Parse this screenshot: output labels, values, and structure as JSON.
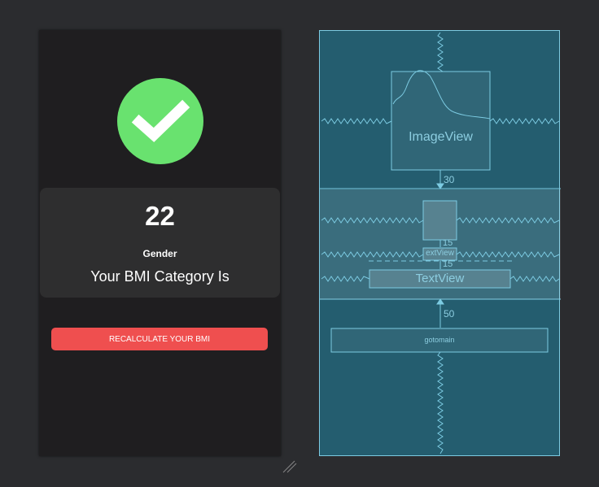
{
  "design": {
    "bmi_value": "22",
    "gender_label": "Gender",
    "category_text": "Your BMI Category Is",
    "recalculate_label": "RECALCULATE YOUR BMI",
    "check_icon": "checkmark-icon",
    "colors": {
      "check_bg": "#69e26f",
      "button_bg": "#ef4f4f",
      "card_bg": "#2e2e2f",
      "screen_bg": "#1f1e20"
    }
  },
  "blueprint": {
    "imageview_label": "ImageView",
    "textview_small_label": "extView",
    "textview_label": "TextView",
    "button_label": "gotomain",
    "margin_top": "30",
    "margin_mid_1": "15",
    "margin_mid_2": "15",
    "margin_bottom": "50",
    "colors": {
      "bg": "#245d6f",
      "line": "#7ccbe2"
    }
  }
}
